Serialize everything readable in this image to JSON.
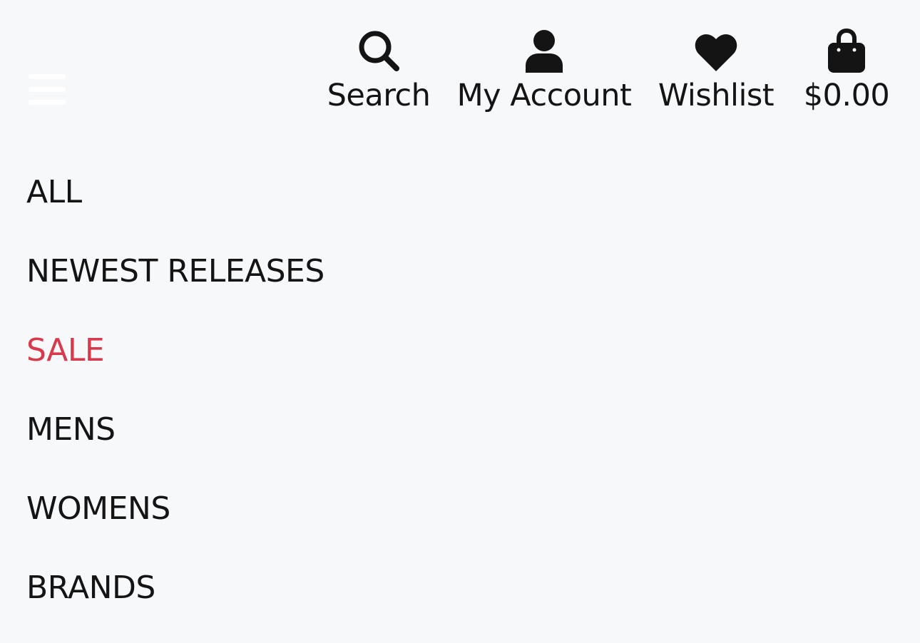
{
  "header": {
    "menu_icon": "hamburger-menu-icon",
    "actions": [
      {
        "label": "Search",
        "icon": "search-icon"
      },
      {
        "label": "My Account",
        "icon": "user-icon"
      },
      {
        "label": "Wishlist",
        "icon": "heart-icon"
      },
      {
        "label": "$0.00",
        "icon": "shopping-bag-icon"
      }
    ]
  },
  "nav": {
    "items": [
      {
        "label": "ALL"
      },
      {
        "label": "NEWEST RELEASES"
      },
      {
        "label": "SALE"
      },
      {
        "label": "MENS"
      },
      {
        "label": "WOMENS"
      },
      {
        "label": "BRANDS"
      }
    ]
  },
  "colors": {
    "background": "#f7f8fa",
    "text": "#141414",
    "sale": "#d63a4c",
    "menu_icon": "#ffffff"
  }
}
